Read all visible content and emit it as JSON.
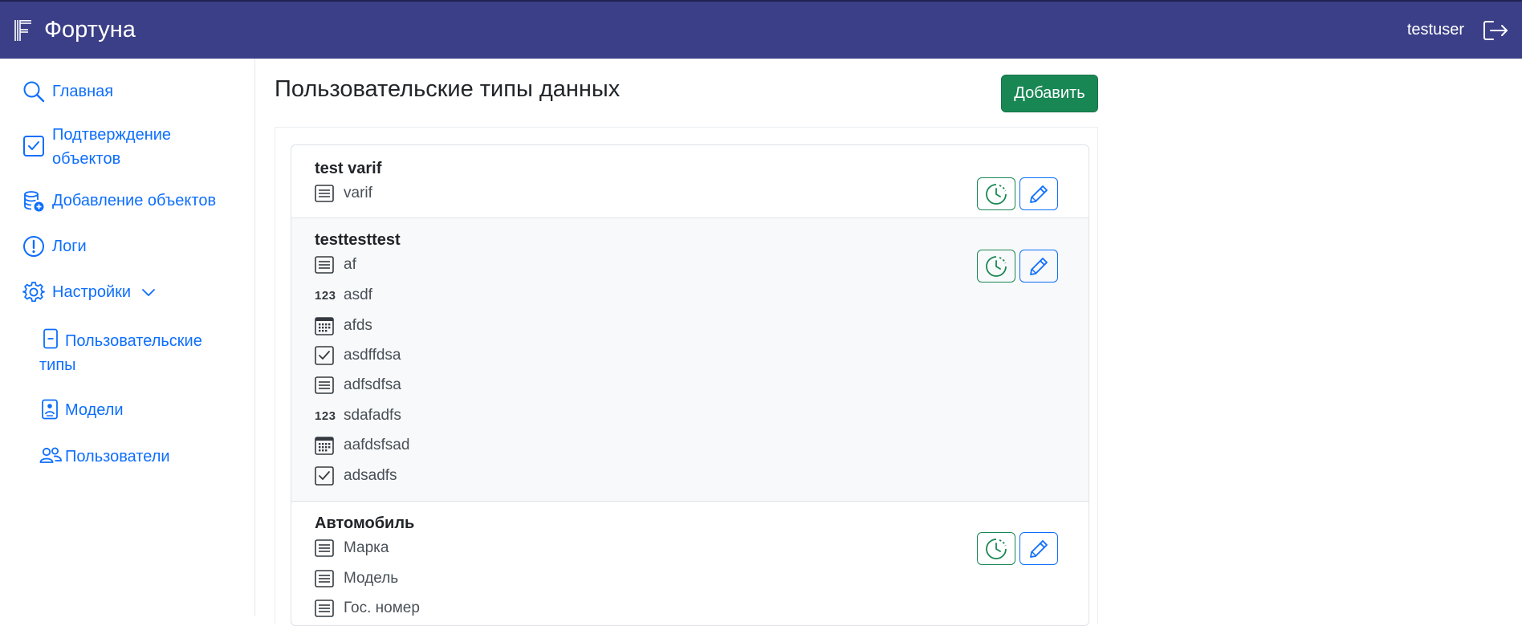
{
  "app": {
    "name": "Фортуна",
    "user": "testuser"
  },
  "sidebar": {
    "items": [
      {
        "label": "Главная",
        "icon": "search-icon"
      },
      {
        "label": "Подтверждение объектов",
        "icon": "check-square-icon"
      },
      {
        "label": "Добавление объектов",
        "icon": "database-add-icon"
      },
      {
        "label": "Логи",
        "icon": "exclamation-circle-icon"
      },
      {
        "label": "Настройки",
        "icon": "gear-icon"
      }
    ],
    "sub_items": [
      {
        "label": "Пользовательские типы",
        "icon": "file-minus-icon"
      },
      {
        "label": "Модели",
        "icon": "file-person-icon"
      },
      {
        "label": "Пользователи",
        "icon": "people-icon"
      }
    ]
  },
  "main": {
    "title": "Пользовательские типы данных",
    "add_button": "Добавить",
    "types": [
      {
        "name": "test varif",
        "fields": [
          {
            "label": "varif",
            "kind": "text"
          }
        ]
      },
      {
        "name": "testtesttest",
        "fields": [
          {
            "label": "af",
            "kind": "text"
          },
          {
            "label": "asdf",
            "kind": "number"
          },
          {
            "label": "afds",
            "kind": "date"
          },
          {
            "label": "asdffdsa",
            "kind": "bool"
          },
          {
            "label": "adfsdfsa",
            "kind": "text"
          },
          {
            "label": "sdafadfs",
            "kind": "number"
          },
          {
            "label": "aafdsfsad",
            "kind": "date"
          },
          {
            "label": "adsadfs",
            "kind": "bool"
          }
        ]
      },
      {
        "name": "Автомобиль",
        "fields": [
          {
            "label": "Марка",
            "kind": "text"
          },
          {
            "label": "Модель",
            "kind": "text"
          },
          {
            "label": "Гос. номер",
            "kind": "text"
          }
        ]
      }
    ],
    "number_glyph": "123"
  },
  "colors": {
    "navbar": "#3b3f87",
    "link": "#0d6efd",
    "success": "#198754",
    "row_alt": "#f8f9fa"
  }
}
